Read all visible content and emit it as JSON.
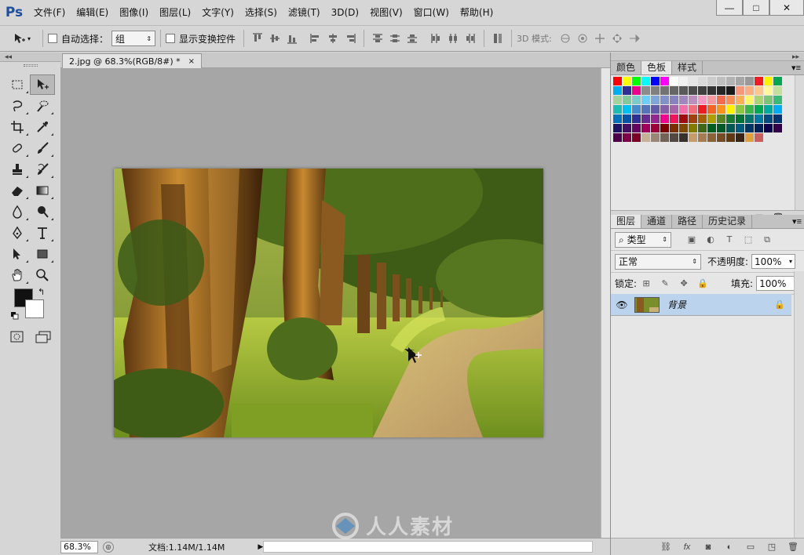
{
  "app": {
    "logo": "Ps"
  },
  "menu": [
    "文件(F)",
    "编辑(E)",
    "图像(I)",
    "图层(L)",
    "文字(Y)",
    "选择(S)",
    "滤镜(T)",
    "3D(D)",
    "视图(V)",
    "窗口(W)",
    "帮助(H)"
  ],
  "window_controls": {
    "minimize": "—",
    "maximize": "□",
    "close": "✕"
  },
  "options": {
    "auto_select_label": "自动选择：",
    "auto_select_value": "组",
    "show_transform_label": "显示变换控件",
    "mode_3d_label": "3D 模式:"
  },
  "document": {
    "tab_title": "2.jpg @ 68.3%(RGB/8#) *",
    "tab_close": "×",
    "zoom": "68.3%",
    "doc_size": "文档:1.14M/1.14M"
  },
  "watermark": {
    "text": "人人素材"
  },
  "swatch_panel": {
    "tabs": [
      "颜色",
      "色板",
      "样式"
    ],
    "active_tab": 1,
    "colors": [
      "#ff0000",
      "#ffff00",
      "#00ff00",
      "#00ffff",
      "#0000ff",
      "#ff00ff",
      "#ffffff",
      "#f2f2f2",
      "#e6e6e6",
      "#d9d9d9",
      "#cccccc",
      "#bfbfbf",
      "#b3b3b3",
      "#a6a6a6",
      "#999999",
      "#ee1c24",
      "#fff200",
      "#00a651",
      "#00aeef",
      "#2e3192",
      "#ec008c",
      "#8c8c8c",
      "#808080",
      "#737373",
      "#666666",
      "#595959",
      "#4d4d4d",
      "#404040",
      "#333333",
      "#262626",
      "#1a1a1a",
      "#f7977a",
      "#fbad82",
      "#fdc68c",
      "#fff799",
      "#c4df9b",
      "#a3d39c",
      "#82ca9c",
      "#7accc8",
      "#6dcff6",
      "#7da7d9",
      "#8393ca",
      "#8882be",
      "#a187be",
      "#bc8dbf",
      "#f49ac2",
      "#f6989d",
      "#f26c4f",
      "#f68e56",
      "#fbaf5d",
      "#fff568",
      "#acd373",
      "#7cc576",
      "#3cb878",
      "#1cbbb4",
      "#00bff3",
      "#448ccb",
      "#5574b9",
      "#605ca8",
      "#855fa8",
      "#a864a8",
      "#f06eaa",
      "#f26d7d",
      "#ed1c24",
      "#f26522",
      "#f7941d",
      "#fff200",
      "#8dc63f",
      "#39b54a",
      "#00a651",
      "#00a99d",
      "#00aeef",
      "#0072bc",
      "#0054a6",
      "#2e3192",
      "#662d91",
      "#92278f",
      "#ec008c",
      "#ed145b",
      "#9e0b0f",
      "#a0410d",
      "#a36209",
      "#aba000",
      "#598527",
      "#197b30",
      "#007236",
      "#00746b",
      "#0076a3",
      "#004b80",
      "#003471",
      "#1b1464",
      "#440e62",
      "#630460",
      "#9e005d",
      "#9e0039",
      "#790000",
      "#7b2e00",
      "#7d4900",
      "#827b00",
      "#406618",
      "#005e20",
      "#005826",
      "#005952",
      "#005b7f",
      "#003663",
      "#002157",
      "#0d004c",
      "#32004b",
      "#4b0049",
      "#7b0046",
      "#7a0026",
      "#c7b299",
      "#998675",
      "#736357",
      "#534741",
      "#37302d",
      "#c69c6d",
      "#a67c52",
      "#8c6239",
      "#754c24",
      "#603913",
      "#3c2415",
      "#e0a040",
      "#c96060"
    ]
  },
  "layers_panel": {
    "tabs": [
      "图层",
      "通道",
      "路径",
      "历史记录"
    ],
    "active_tab": 0,
    "filter_label": "类型",
    "blend_mode": "正常",
    "opacity_label": "不透明度:",
    "opacity_value": "100%",
    "lock_label": "锁定:",
    "fill_label": "填充:",
    "fill_value": "100%",
    "layers": [
      {
        "name": "背景",
        "visible": true,
        "locked": true
      }
    ]
  },
  "colors": {
    "accent_selected_layer": "#bcd3ee",
    "canvas_bg": "#a6a6a6",
    "ui_bg": "#d6d6d6"
  }
}
